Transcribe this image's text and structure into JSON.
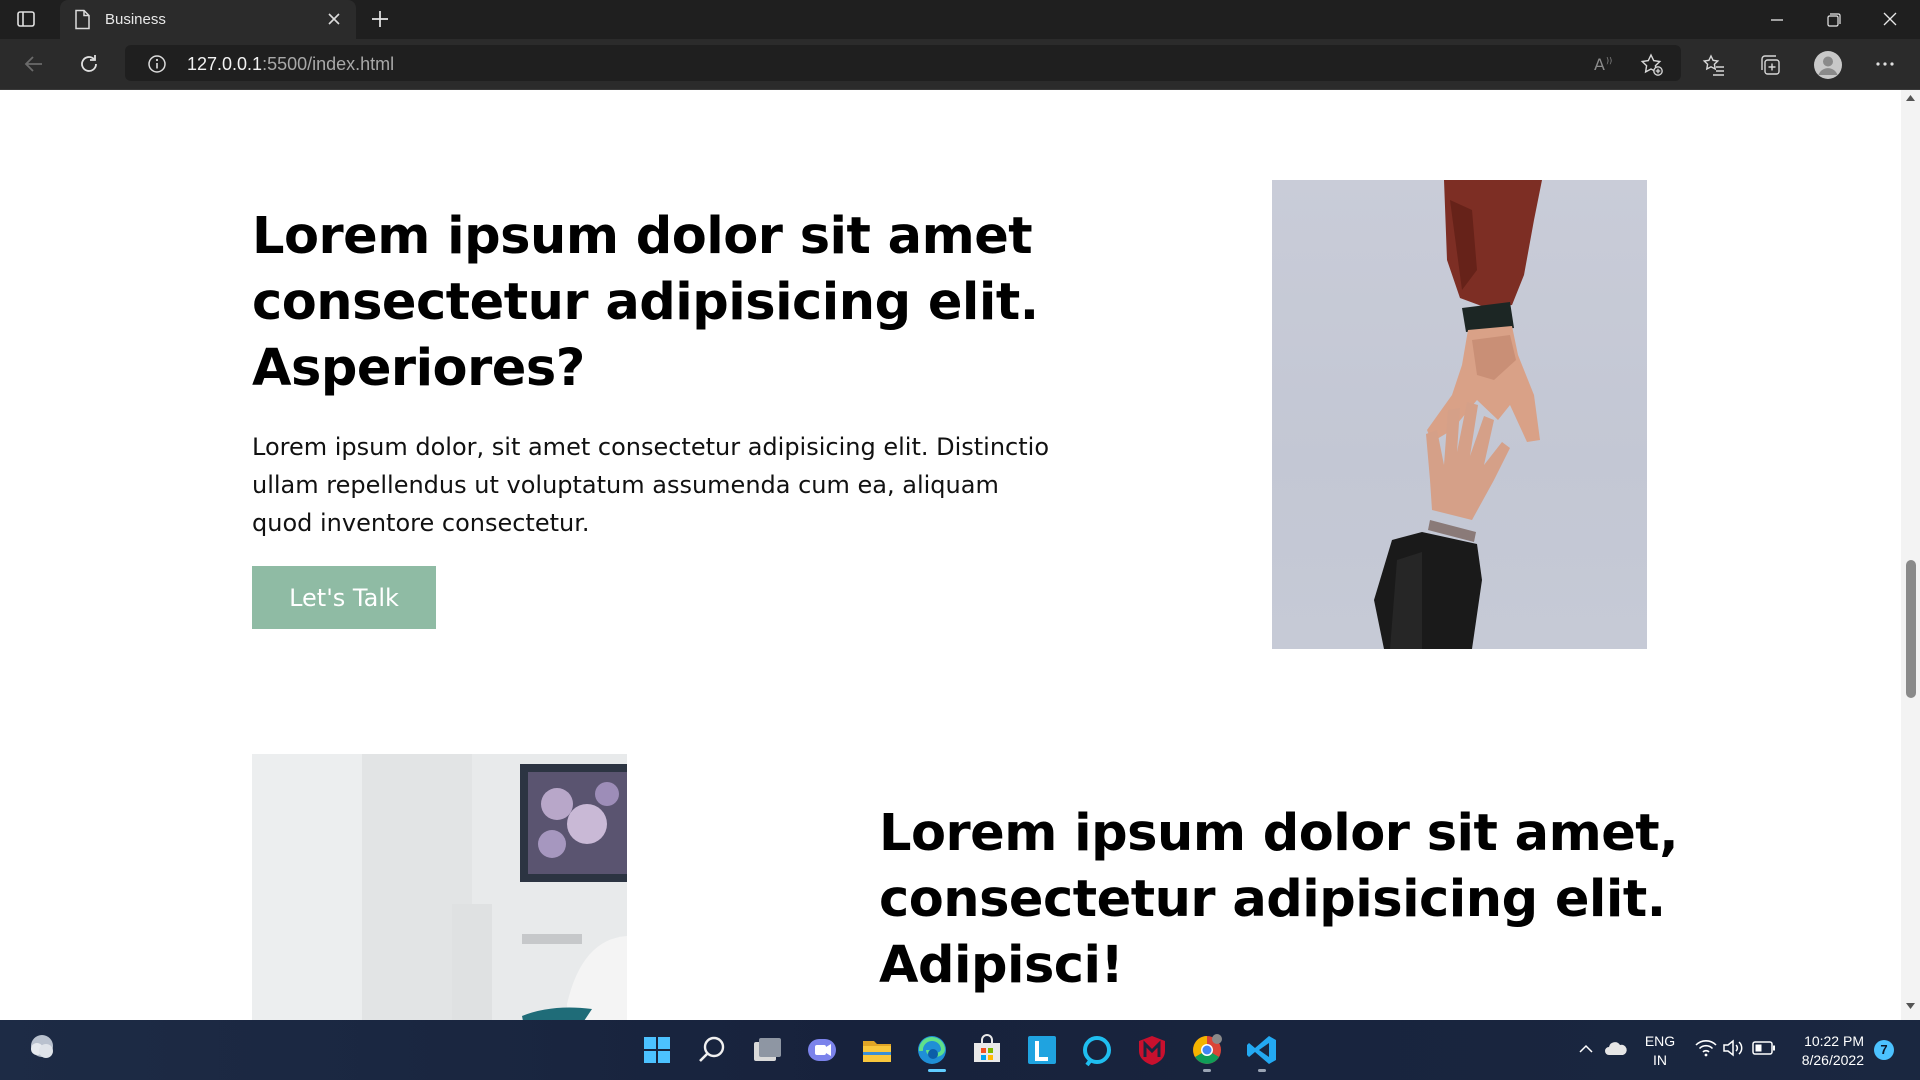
{
  "browser": {
    "tab": {
      "title": "Business",
      "page_icon": "page-icon"
    },
    "address": {
      "host": "127.0.0.1",
      "path": ":5500/index.html"
    }
  },
  "page": {
    "section1": {
      "heading": "Lorem ipsum dolor sit amet consectetur adipisicing elit. Asperiores?",
      "body": "Lorem ipsum dolor, sit amet consectetur adipisicing elit. Distinctio ullam repellendus ut voluptatum assumenda cum ea, aliquam quod inventore consectetur.",
      "cta_label": "Let's Talk",
      "cta_color": "#8fbba4",
      "image": "two-hands-reaching-photo"
    },
    "section2": {
      "heading": "Lorem ipsum dolor sit amet, consectetur adipisicing elit. Adipisci!",
      "image": "person-in-cap-at-desk-photo"
    }
  },
  "taskbar": {
    "apps": [
      "windows-start-icon",
      "search-icon",
      "task-view-icon",
      "teams-chat-icon",
      "file-explorer-icon",
      "edge-icon",
      "microsoft-store-icon",
      "l-app-icon",
      "alexa-icon",
      "mcafee-icon",
      "chrome-icon",
      "vscode-icon"
    ],
    "tray": {
      "lang_line1": "ENG",
      "lang_line2": "IN",
      "time": "10:22 PM",
      "date": "8/26/2022",
      "notification_count": "7"
    }
  }
}
